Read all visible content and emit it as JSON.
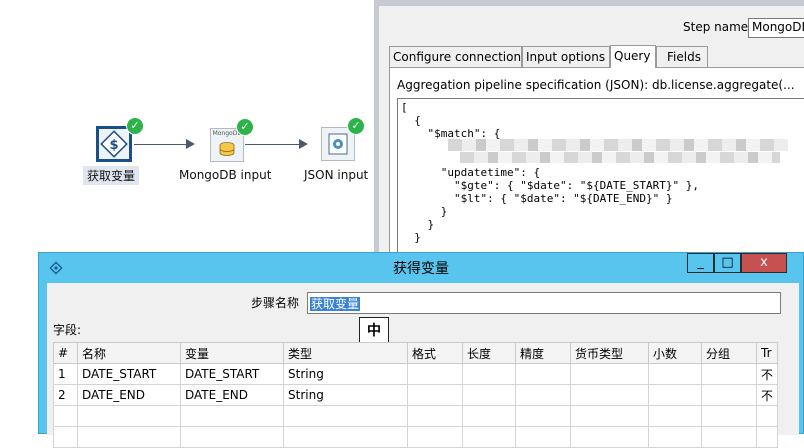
{
  "canvas": {
    "steps": [
      {
        "label": "获取变量",
        "icon": "dollar-variable-icon",
        "status": "ok"
      },
      {
        "label": "MongoDB input",
        "icon": "mongodb-icon",
        "icon_text": "MongoDB",
        "status": "ok"
      },
      {
        "label": "JSON input",
        "icon": "json-input-icon",
        "status": "ok"
      }
    ],
    "colors": {
      "hop": "#4c5b6a",
      "success": "#2db34a",
      "selected_border": "#1b4f8a"
    }
  },
  "mongo_dialog": {
    "step_name_label": "Step name",
    "step_name_value": "MongoDB",
    "tabs": [
      "Configure connection",
      "Input options",
      "Query",
      "Fields"
    ],
    "active_tab": "Query",
    "pipeline_label": "Aggregation pipeline specification (JSON): db.license.aggregate(...",
    "code_lines": [
      "[",
      "  {",
      "    \"$match\": {",
      "",
      "",
      "      \"updatetime\": {",
      "        \"$gte\": { \"$date\": \"${DATE_START}\" },",
      "        \"$lt\": { \"$date\": \"${DATE_END}\" }",
      "      }",
      "    }",
      "  }"
    ]
  },
  "var_dialog": {
    "title": "获得变量",
    "window_buttons": {
      "minimize": "_",
      "maximize": "□",
      "close": "x"
    },
    "step_name_label": "步骤名称",
    "step_name_value": "获取变量",
    "ime_indicator": "中",
    "fields_label": "字段:",
    "columns": [
      "#",
      "名称",
      "变量",
      "类型",
      "格式",
      "长度",
      "精度",
      "货币类型",
      "小数",
      "分组",
      "Tr"
    ],
    "rows": [
      [
        "1",
        "DATE_START",
        "DATE_START",
        "String",
        "",
        "",
        "",
        "",
        "",
        "",
        "不"
      ],
      [
        "2",
        "DATE_END",
        "DATE_END",
        "String",
        "",
        "",
        "",
        "",
        "",
        "",
        "不"
      ],
      [
        "",
        "",
        "",
        "",
        "",
        "",
        "",
        "",
        "",
        "",
        ""
      ],
      [
        "",
        "",
        "",
        "",
        "",
        "",
        "",
        "",
        "",
        "",
        ""
      ]
    ],
    "colors": {
      "titlebar": "#58c5ee",
      "close": "#c75050",
      "selection": "#3a82d6"
    }
  }
}
